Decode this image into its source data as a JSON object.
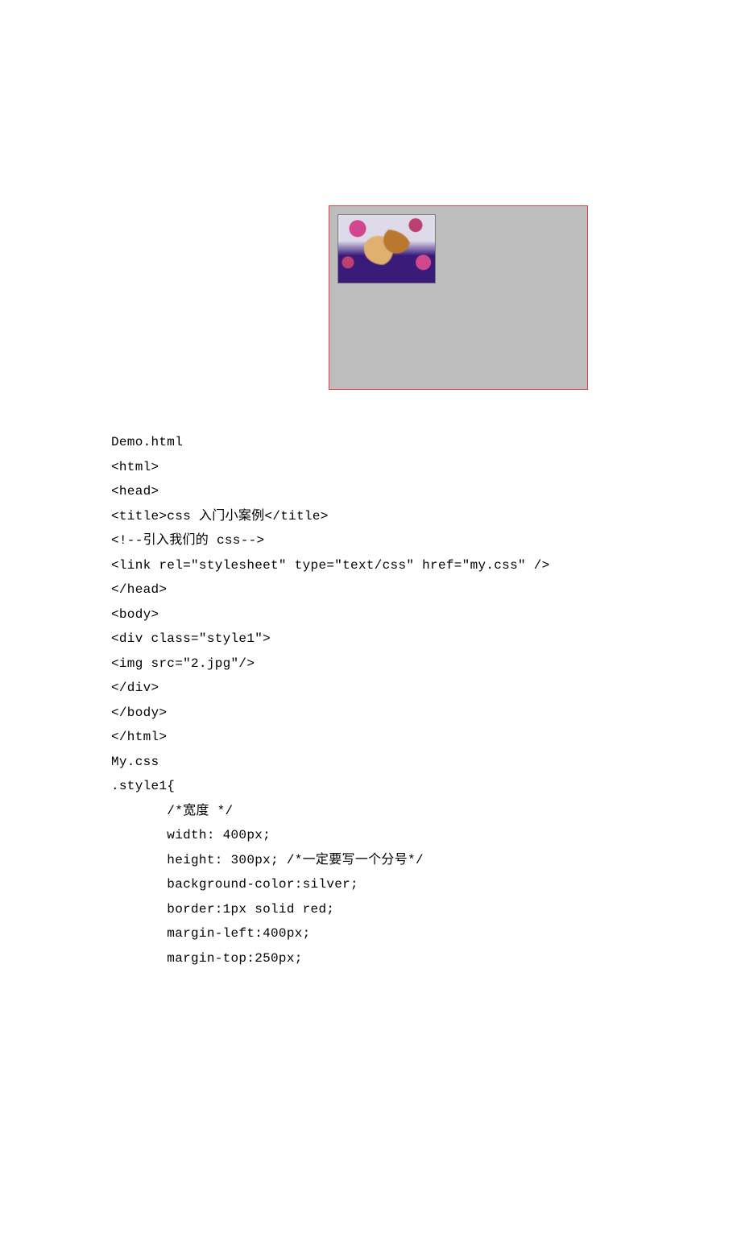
{
  "demo_filename": "Demo.html",
  "code": {
    "l01": "<html>",
    "l02": "<head>",
    "l03": "<title>css 入门小案例</title>",
    "l04": "<!--引入我们的 css-->",
    "l05": "<link rel=\"stylesheet\" type=\"text/css\" href=\"my.css\" />",
    "l06": "</head>",
    "l07": "<body>",
    "l08": "<div class=\"style1\">",
    "l09": "<img src=\"2.jpg\"/>",
    "l10": "</div>",
    "l11": "</body>",
    "l12": "</html>"
  },
  "css_filename": "My.css",
  "css": {
    "l01": ".style1{",
    "l02": "       /*宽度 */",
    "l03": "       width: 400px;",
    "l04": "       height: 300px; /*一定要写一个分号*/",
    "l05": "       background-color:silver;",
    "l06": "       border:1px solid red;",
    "l07": "       margin-left:400px;",
    "l08": "       margin-top:250px;"
  }
}
